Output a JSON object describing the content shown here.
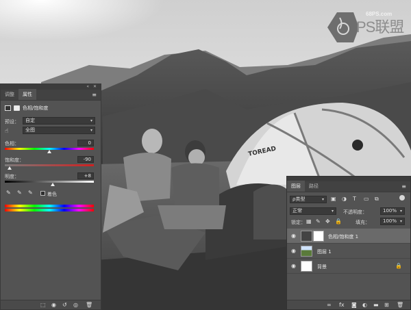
{
  "watermark": {
    "site": "68PS.com",
    "brand": "PS联盟"
  },
  "properties_panel": {
    "tabs": [
      "调整",
      "属性"
    ],
    "active_tab": "属性",
    "title": "色相/饱和度",
    "preset_label": "预设：",
    "preset_value": "自定",
    "channel_value": "全图",
    "hue": {
      "label": "色相：",
      "value": "0",
      "fraction": 0.5
    },
    "saturation": {
      "label": "饱和度：",
      "value": "-90",
      "fraction": 0.05
    },
    "lightness": {
      "label": "明度：",
      "value": "+8",
      "fraction": 0.54
    },
    "colorize_label": "着色",
    "colorize_checked": false
  },
  "layers_panel": {
    "tabs": [
      "图层",
      "路径"
    ],
    "active_tab": "图层",
    "filter_kind": "ρ类型",
    "blend_mode": "正常",
    "opacity_label": "不透明度：",
    "opacity_value": "100%",
    "lock_label": "锁定：",
    "fill_label": "填充：",
    "fill_value": "100%",
    "layers": [
      {
        "name": "色相/饱和度 1",
        "visible": true,
        "type": "adjustment",
        "selected": true
      },
      {
        "name": "图层 1",
        "visible": true,
        "type": "image",
        "selected": false
      },
      {
        "name": "背景",
        "visible": true,
        "type": "background",
        "locked": true,
        "selected": false
      }
    ]
  },
  "photo_text": "TOREAD"
}
